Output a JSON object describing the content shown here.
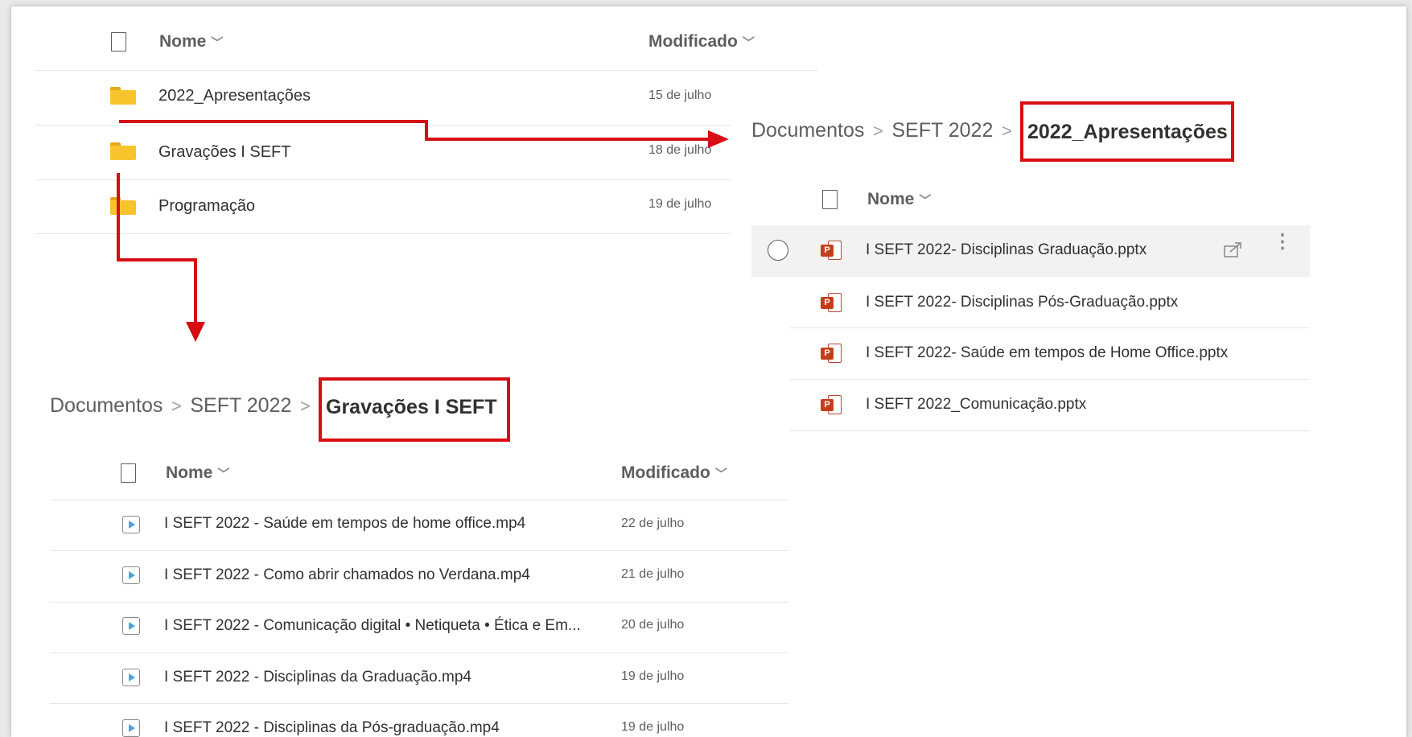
{
  "top_list": {
    "col_name": "Nome",
    "col_modified": "Modificado",
    "rows": [
      {
        "name": "2022_Apresentações",
        "date": "15 de julho"
      },
      {
        "name": "Gravações I SEFT",
        "date": "18 de julho"
      },
      {
        "name": "Programação",
        "date": "19 de julho"
      }
    ]
  },
  "apresentacoes": {
    "breadcrumb": [
      "Documentos",
      "SEFT 2022",
      "2022_Apresentações"
    ],
    "col_name": "Nome",
    "files": [
      {
        "name": "I SEFT 2022- Disciplinas Graduação.pptx",
        "icon": "powerpoint-icon"
      },
      {
        "name": "I SEFT 2022- Disciplinas Pós-Graduação.pptx",
        "icon": "powerpoint-icon"
      },
      {
        "name": "I SEFT 2022- Saúde em tempos de Home Office.pptx",
        "icon": "powerpoint-icon"
      },
      {
        "name": "I SEFT 2022_Comunicação.pptx",
        "icon": "powerpoint-icon"
      }
    ]
  },
  "gravacoes": {
    "breadcrumb": [
      "Documentos",
      "SEFT 2022",
      "Gravações I SEFT"
    ],
    "col_name": "Nome",
    "col_modified": "Modificado",
    "files": [
      {
        "name": "I SEFT  2022 - Saúde em tempos de home office.mp4",
        "date": "22 de julho"
      },
      {
        "name": "I SEFT 2022 - Como abrir chamados no Verdana.mp4",
        "date": "21 de julho"
      },
      {
        "name": "I SEFT 2022 - Comunicação digital • Netiqueta • Ética e Em...",
        "date": "20 de julho"
      },
      {
        "name": "I SEFT 2022 - Disciplinas da Graduação.mp4",
        "date": "19 de julho"
      },
      {
        "name": "I SEFT 2022 - Disciplinas da Pós-graduação.mp4",
        "date": "19 de julho"
      }
    ]
  },
  "colors": {
    "highlight": "#d60d12",
    "folder": "#f8c42d",
    "powerpoint": "#c43e1c"
  }
}
